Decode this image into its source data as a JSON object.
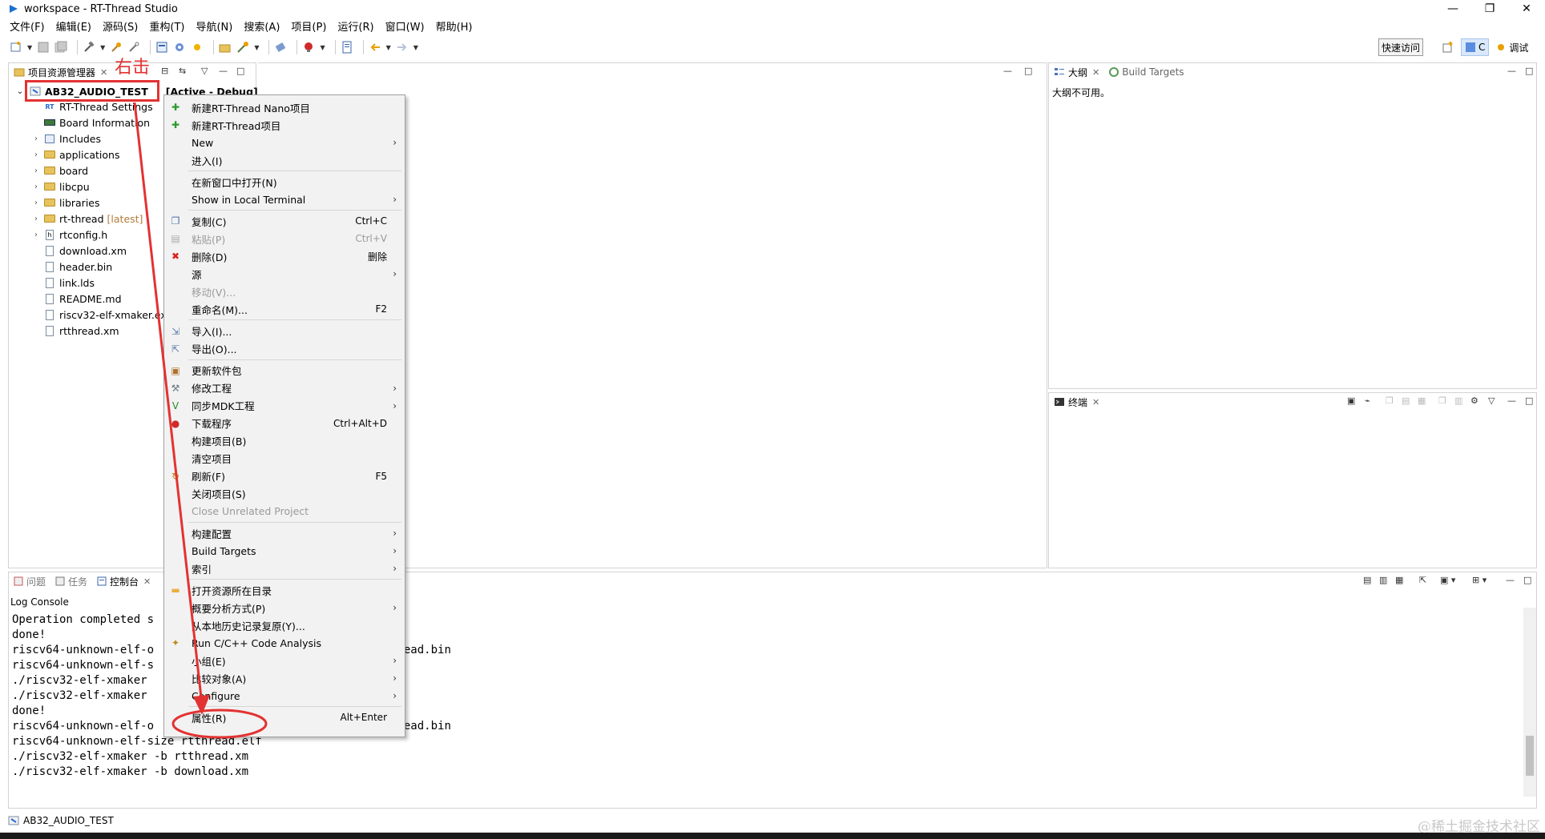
{
  "window": {
    "title": "workspace - RT-Thread Studio",
    "controls": [
      "minimize",
      "restore",
      "close"
    ]
  },
  "menubar": [
    "文件(F)",
    "编辑(E)",
    "源码(S)",
    "重构(T)",
    "导航(N)",
    "搜索(A)",
    "项目(P)",
    "运行(R)",
    "窗口(W)",
    "帮助(H)"
  ],
  "toolbar": {
    "quick_access": "快速访问",
    "perspectives": [
      {
        "label": "C",
        "icon": "c-perspective-icon",
        "active": true
      },
      {
        "label": "调试",
        "icon": "debug-perspective-icon",
        "active": false
      }
    ]
  },
  "explorer": {
    "tab_label": "项目资源管理器",
    "root": {
      "name": "AB32_AUDIO_TEST",
      "suffix": "[Active - Debug]"
    },
    "items": [
      {
        "label": "RT-Thread Settings",
        "icon": "rt-settings-icon",
        "expandable": false,
        "tag": ""
      },
      {
        "label": "Board Information",
        "icon": "board-info-icon",
        "expandable": false,
        "tag": ""
      },
      {
        "label": "Includes",
        "icon": "includes-icon",
        "expandable": true,
        "tag": ""
      },
      {
        "label": "applications",
        "icon": "folder-icon",
        "expandable": true,
        "tag": ""
      },
      {
        "label": "board",
        "icon": "folder-icon",
        "expandable": true,
        "tag": ""
      },
      {
        "label": "libcpu",
        "icon": "folder-icon",
        "expandable": true,
        "tag": ""
      },
      {
        "label": "libraries",
        "icon": "folder-icon",
        "expandable": true,
        "tag": ""
      },
      {
        "label": "rt-thread",
        "icon": "folder-icon",
        "expandable": true,
        "tag": "[latest]"
      },
      {
        "label": "rtconfig.h",
        "icon": "header-file-icon",
        "expandable": true,
        "tag": ""
      },
      {
        "label": "download.xm",
        "icon": "file-icon",
        "expandable": false,
        "tag": ""
      },
      {
        "label": "header.bin",
        "icon": "file-icon",
        "expandable": false,
        "tag": ""
      },
      {
        "label": "link.lds",
        "icon": "file-icon",
        "expandable": false,
        "tag": ""
      },
      {
        "label": "README.md",
        "icon": "file-icon",
        "expandable": false,
        "tag": ""
      },
      {
        "label": "riscv32-elf-xmaker.exe",
        "icon": "exe-icon",
        "expandable": false,
        "tag": ""
      },
      {
        "label": "rtthread.xm",
        "icon": "file-icon",
        "expandable": false,
        "tag": ""
      }
    ]
  },
  "annotations": {
    "right_click_label": "右击"
  },
  "outline": {
    "tab_label": "大纲",
    "tab2_label": "Build Targets",
    "message": "大纲不可用。"
  },
  "terminal": {
    "tab_label": "终端"
  },
  "console": {
    "tabs": [
      "问题",
      "任务",
      "控制台"
    ],
    "active_tab": "控制台",
    "subtitle": "Log Console",
    "lines": [
      "Operation completed s",
      "done!",
      "riscv64-unknown-elf-o                                    read.bin",
      "riscv64-unknown-elf-s",
      "./riscv32-elf-xmaker",
      "./riscv32-elf-xmaker",
      "done!",
      "riscv64-unknown-elf-o                                    read.bin",
      "riscv64-unknown-elf-size rtthread.elf",
      "./riscv32-elf-xmaker -b rtthread.xm",
      "./riscv32-elf-xmaker -b download.xm"
    ]
  },
  "context_menu": {
    "items": [
      {
        "label": "新建RT-Thread Nano项目",
        "shortcut": "",
        "submenu": false,
        "disabled": false,
        "icon": "new-nano-project-icon",
        "sep_before": false
      },
      {
        "label": "新建RT-Thread项目",
        "shortcut": "",
        "submenu": false,
        "disabled": false,
        "icon": "new-project-icon",
        "sep_before": false
      },
      {
        "label": "New",
        "shortcut": "",
        "submenu": true,
        "disabled": false,
        "icon": "",
        "sep_before": false
      },
      {
        "label": "进入(I)",
        "shortcut": "",
        "submenu": false,
        "disabled": false,
        "icon": "",
        "sep_before": false
      },
      {
        "label": "在新窗口中打开(N)",
        "shortcut": "",
        "submenu": false,
        "disabled": false,
        "icon": "",
        "sep_before": true
      },
      {
        "label": "Show in Local Terminal",
        "shortcut": "",
        "submenu": true,
        "disabled": false,
        "icon": "",
        "sep_before": false
      },
      {
        "label": "复制(C)",
        "shortcut": "Ctrl+C",
        "submenu": false,
        "disabled": false,
        "icon": "copy-icon",
        "sep_before": true
      },
      {
        "label": "粘贴(P)",
        "shortcut": "Ctrl+V",
        "submenu": false,
        "disabled": true,
        "icon": "paste-icon",
        "sep_before": false
      },
      {
        "label": "删除(D)",
        "shortcut": "删除",
        "submenu": false,
        "disabled": false,
        "icon": "delete-icon",
        "sep_before": false
      },
      {
        "label": "源",
        "shortcut": "",
        "submenu": true,
        "disabled": false,
        "icon": "",
        "sep_before": false
      },
      {
        "label": "移动(V)...",
        "shortcut": "",
        "submenu": false,
        "disabled": true,
        "icon": "",
        "sep_before": false
      },
      {
        "label": "重命名(M)...",
        "shortcut": "F2",
        "submenu": false,
        "disabled": false,
        "icon": "",
        "sep_before": false
      },
      {
        "label": "导入(I)...",
        "shortcut": "",
        "submenu": false,
        "disabled": false,
        "icon": "import-icon",
        "sep_before": true
      },
      {
        "label": "导出(O)...",
        "shortcut": "",
        "submenu": false,
        "disabled": false,
        "icon": "export-icon",
        "sep_before": false
      },
      {
        "label": "更新软件包",
        "shortcut": "",
        "submenu": false,
        "disabled": false,
        "icon": "package-icon",
        "sep_before": true
      },
      {
        "label": "修改工程",
        "shortcut": "",
        "submenu": true,
        "disabled": false,
        "icon": "wrench-icon",
        "sep_before": false
      },
      {
        "label": "同步MDK工程",
        "shortcut": "",
        "submenu": true,
        "disabled": false,
        "icon": "mdk-icon",
        "sep_before": false
      },
      {
        "label": "下载程序",
        "shortcut": "Ctrl+Alt+D",
        "submenu": false,
        "disabled": false,
        "icon": "download-icon",
        "sep_before": false
      },
      {
        "label": "构建项目(B)",
        "shortcut": "",
        "submenu": false,
        "disabled": false,
        "icon": "",
        "sep_before": false
      },
      {
        "label": "清空项目",
        "shortcut": "",
        "submenu": false,
        "disabled": false,
        "icon": "",
        "sep_before": false
      },
      {
        "label": "刷新(F)",
        "shortcut": "F5",
        "submenu": false,
        "disabled": false,
        "icon": "refresh-icon",
        "sep_before": false
      },
      {
        "label": "关闭项目(S)",
        "shortcut": "",
        "submenu": false,
        "disabled": false,
        "icon": "",
        "sep_before": false
      },
      {
        "label": "Close Unrelated Project",
        "shortcut": "",
        "submenu": false,
        "disabled": true,
        "icon": "",
        "sep_before": false
      },
      {
        "label": "构建配置",
        "shortcut": "",
        "submenu": true,
        "disabled": false,
        "icon": "",
        "sep_before": true
      },
      {
        "label": "Build Targets",
        "shortcut": "",
        "submenu": true,
        "disabled": false,
        "icon": "",
        "sep_before": false
      },
      {
        "label": "索引",
        "shortcut": "",
        "submenu": true,
        "disabled": false,
        "icon": "",
        "sep_before": false
      },
      {
        "label": "打开资源所在目录",
        "shortcut": "",
        "submenu": false,
        "disabled": false,
        "icon": "open-folder-icon",
        "sep_before": true
      },
      {
        "label": "概要分析方式(P)",
        "shortcut": "",
        "submenu": true,
        "disabled": false,
        "icon": "",
        "sep_before": false
      },
      {
        "label": "从本地历史记录复原(Y)...",
        "shortcut": "",
        "submenu": false,
        "disabled": false,
        "icon": "",
        "sep_before": false
      },
      {
        "label": "Run C/C++ Code Analysis",
        "shortcut": "",
        "submenu": false,
        "disabled": false,
        "icon": "code-analysis-icon",
        "sep_before": false
      },
      {
        "label": "小组(E)",
        "shortcut": "",
        "submenu": true,
        "disabled": false,
        "icon": "",
        "sep_before": false
      },
      {
        "label": "比较对象(A)",
        "shortcut": "",
        "submenu": true,
        "disabled": false,
        "icon": "",
        "sep_before": false
      },
      {
        "label": "Configure",
        "shortcut": "",
        "submenu": true,
        "disabled": false,
        "icon": "",
        "sep_before": false
      },
      {
        "label": "属性(R)",
        "shortcut": "Alt+Enter",
        "submenu": false,
        "disabled": false,
        "icon": "",
        "sep_before": true
      }
    ]
  },
  "statusbar": {
    "project": "AB32_AUDIO_TEST"
  },
  "watermark": "@稀土掘金技术社区",
  "colors": {
    "annotation_red": "#e33232",
    "menu_bg": "#f2f2f2",
    "tag_latest": "#b47b3a"
  }
}
